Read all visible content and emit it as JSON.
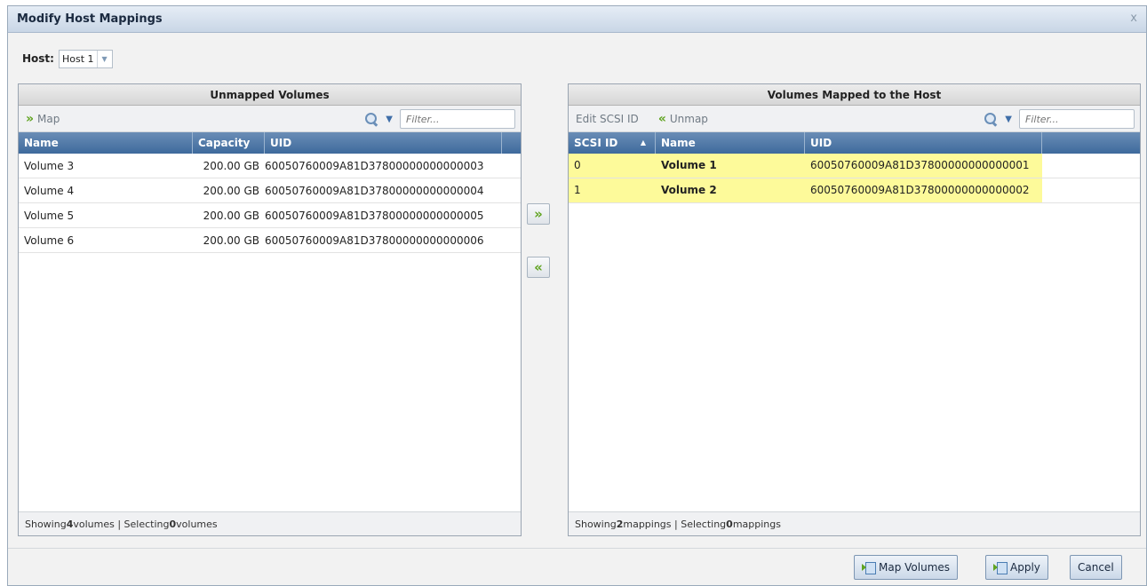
{
  "dialog": {
    "title": "Modify Host Mappings",
    "close_glyph": "x"
  },
  "host": {
    "label": "Host:",
    "value": "Host 1"
  },
  "unmapped": {
    "title": "Unmapped Volumes",
    "map_label": "Map",
    "filter_placeholder": "Filter...",
    "columns": [
      "Name",
      "Capacity",
      "UID"
    ],
    "rows": [
      {
        "name": "Volume 3",
        "capacity": "200.00 GB",
        "uid": "60050760009A81D37800000000000003"
      },
      {
        "name": "Volume 4",
        "capacity": "200.00 GB",
        "uid": "60050760009A81D37800000000000004"
      },
      {
        "name": "Volume 5",
        "capacity": "200.00 GB",
        "uid": "60050760009A81D37800000000000005"
      },
      {
        "name": "Volume 6",
        "capacity": "200.00 GB",
        "uid": "60050760009A81D37800000000000006"
      }
    ],
    "status": {
      "showing_prefix": "Showing ",
      "showing_count": "4",
      "showing_suffix": " volumes | Selecting ",
      "selecting_count": "0",
      "selecting_suffix": " volumes"
    }
  },
  "mapped": {
    "title": "Volumes Mapped to the Host",
    "edit_label": "Edit SCSI ID",
    "unmap_label": "Unmap",
    "filter_placeholder": "Filter...",
    "columns": [
      "SCSI ID",
      "Name",
      "UID"
    ],
    "rows": [
      {
        "scsi_id": "0",
        "name": "Volume 1",
        "uid": "60050760009A81D37800000000000001"
      },
      {
        "scsi_id": "1",
        "name": "Volume 2",
        "uid": "60050760009A81D37800000000000002"
      }
    ],
    "status": {
      "showing_prefix": "Showing ",
      "showing_count": "2",
      "showing_suffix": " mappings | Selecting ",
      "selecting_count": "0",
      "selecting_suffix": " mappings"
    }
  },
  "icons": {
    "map": "chevron-right-icon",
    "unmap": "chevron-left-icon",
    "search": "search-icon",
    "dropdown": "dropdown-arrow-icon",
    "button": "map-volume-icon"
  },
  "colors": {
    "header_blue": "#4f79a8",
    "highlight": "#fdfa9a",
    "chevron_green": "#5fa31f"
  },
  "buttons": {
    "map_volumes": "Map Volumes",
    "apply": "Apply",
    "cancel": "Cancel"
  }
}
